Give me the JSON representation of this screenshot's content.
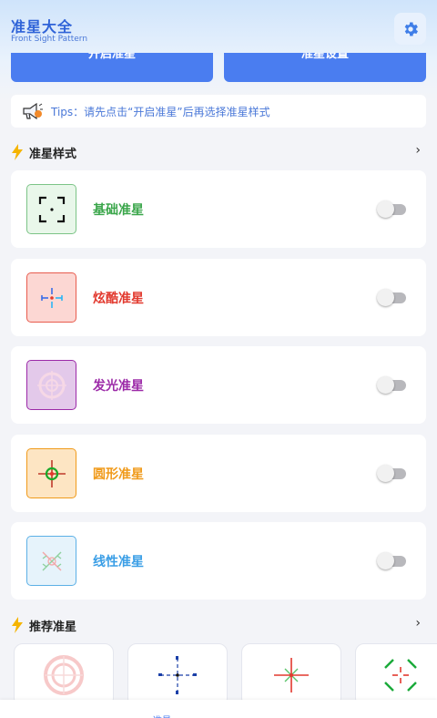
{
  "header": {
    "title": "准星大全",
    "subtitle": "Front Sight Pattern",
    "settings_icon": "gear-icon"
  },
  "actions": {
    "open_label": "开启准星",
    "settings_label": "准星设置"
  },
  "tips": {
    "text": "Tips：请先点击“开启准星”后再选择准星样式"
  },
  "styles_section": {
    "title": "准星样式",
    "items": [
      {
        "label": "基础准星",
        "color": "#3aa64a",
        "enabled": false
      },
      {
        "label": "炫酷准星",
        "color": "#e2392e",
        "enabled": false
      },
      {
        "label": "发光准星",
        "color": "#9c2aa8",
        "enabled": false
      },
      {
        "label": "圆形准星",
        "color": "#f09a1a",
        "enabled": false
      },
      {
        "label": "线性准星",
        "color": "#3a9ee6",
        "enabled": false
      }
    ]
  },
  "recommend_section": {
    "title": "推荐准星",
    "items": [
      "pink-ring-crosshair",
      "blue-dot-crosshair",
      "red-green-crosshair",
      "green-bracket-crosshair"
    ]
  },
  "bottom_nav": {
    "items": [
      "准星"
    ]
  }
}
